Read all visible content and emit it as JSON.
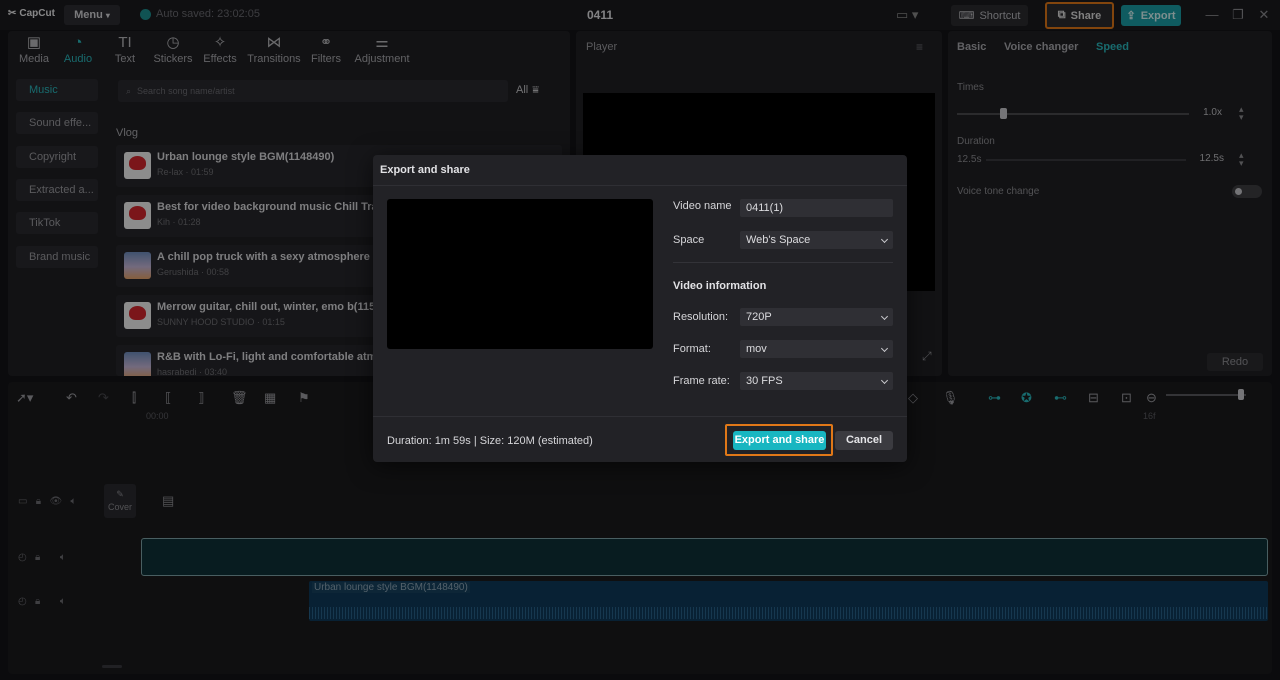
{
  "app": {
    "logo_text": "CapCut",
    "menu_label": "Menu",
    "autosave_text": "Auto saved: 23:02:05",
    "project_title": "0411",
    "shortcut_label": "Shortcut",
    "share_label": "Share",
    "export_label": "Export"
  },
  "tool_tabs": [
    {
      "label": "Media",
      "icon": "media-icon"
    },
    {
      "label": "Audio",
      "icon": "audio-icon"
    },
    {
      "label": "Text",
      "icon": "text-icon"
    },
    {
      "label": "Stickers",
      "icon": "stickers-icon"
    },
    {
      "label": "Effects",
      "icon": "effects-icon"
    },
    {
      "label": "Transitions",
      "icon": "transitions-icon"
    },
    {
      "label": "Filters",
      "icon": "filters-icon"
    },
    {
      "label": "Adjustment",
      "icon": "adjustment-icon"
    }
  ],
  "audio_sidebar": [
    "Music",
    "Sound effe...",
    "Copyright",
    "Extracted a...",
    "TikTok",
    "Brand music"
  ],
  "search": {
    "placeholder": "Search song name/artist"
  },
  "filter_label": "All",
  "section_title": "Vlog",
  "songs": [
    {
      "title": "Urban lounge style BGM(1148490)",
      "meta": "Re-lax · 01:59"
    },
    {
      "title": "Best for video background music Chill Trap",
      "meta": "Kih · 01:28"
    },
    {
      "title": "A chill pop truck with a sexy atmosphere ♪",
      "meta": "Gerushida · 00:58"
    },
    {
      "title": "Merrow guitar, chill out, winter, emo b(115",
      "meta": "SUNNY HOOD STUDIO · 01:15"
    },
    {
      "title": "R&B with Lo-Fi, light and comfortable atmo",
      "meta": "hasrabedi · 03:40"
    }
  ],
  "player": {
    "label": "Player"
  },
  "speed_panel": {
    "tabs": [
      "Basic",
      "Voice changer",
      "Speed"
    ],
    "times_label": "Times",
    "times_value": "1.0x",
    "duration_label": "Duration",
    "duration_from": "12.5s",
    "duration_value": "12.5s",
    "voice_tone_label": "Voice tone change",
    "redo_label": "Redo"
  },
  "timeline": {
    "ruler_start": "00:00",
    "ruler_end": "16f",
    "cover_label": "Cover",
    "audio_clip_label": "Urban lounge style BGM(1148490)"
  },
  "dialog": {
    "title": "Export and share",
    "video_name_label": "Video name",
    "video_name_value": "0411(1)",
    "space_label": "Space",
    "space_value": "Web's Space",
    "video_info_title": "Video information",
    "resolution_label": "Resolution:",
    "resolution_value": "720P",
    "format_label": "Format:",
    "format_value": "mov",
    "frame_rate_label": "Frame rate:",
    "frame_rate_value": "30 FPS",
    "duration_text": "Duration: 1m 59s | Size: 120M (estimated)",
    "export_share_label": "Export and share",
    "cancel_label": "Cancel"
  },
  "colors": {
    "accent": "#2ab8bd",
    "highlight": "#e07818",
    "button": "#18b6c1"
  }
}
